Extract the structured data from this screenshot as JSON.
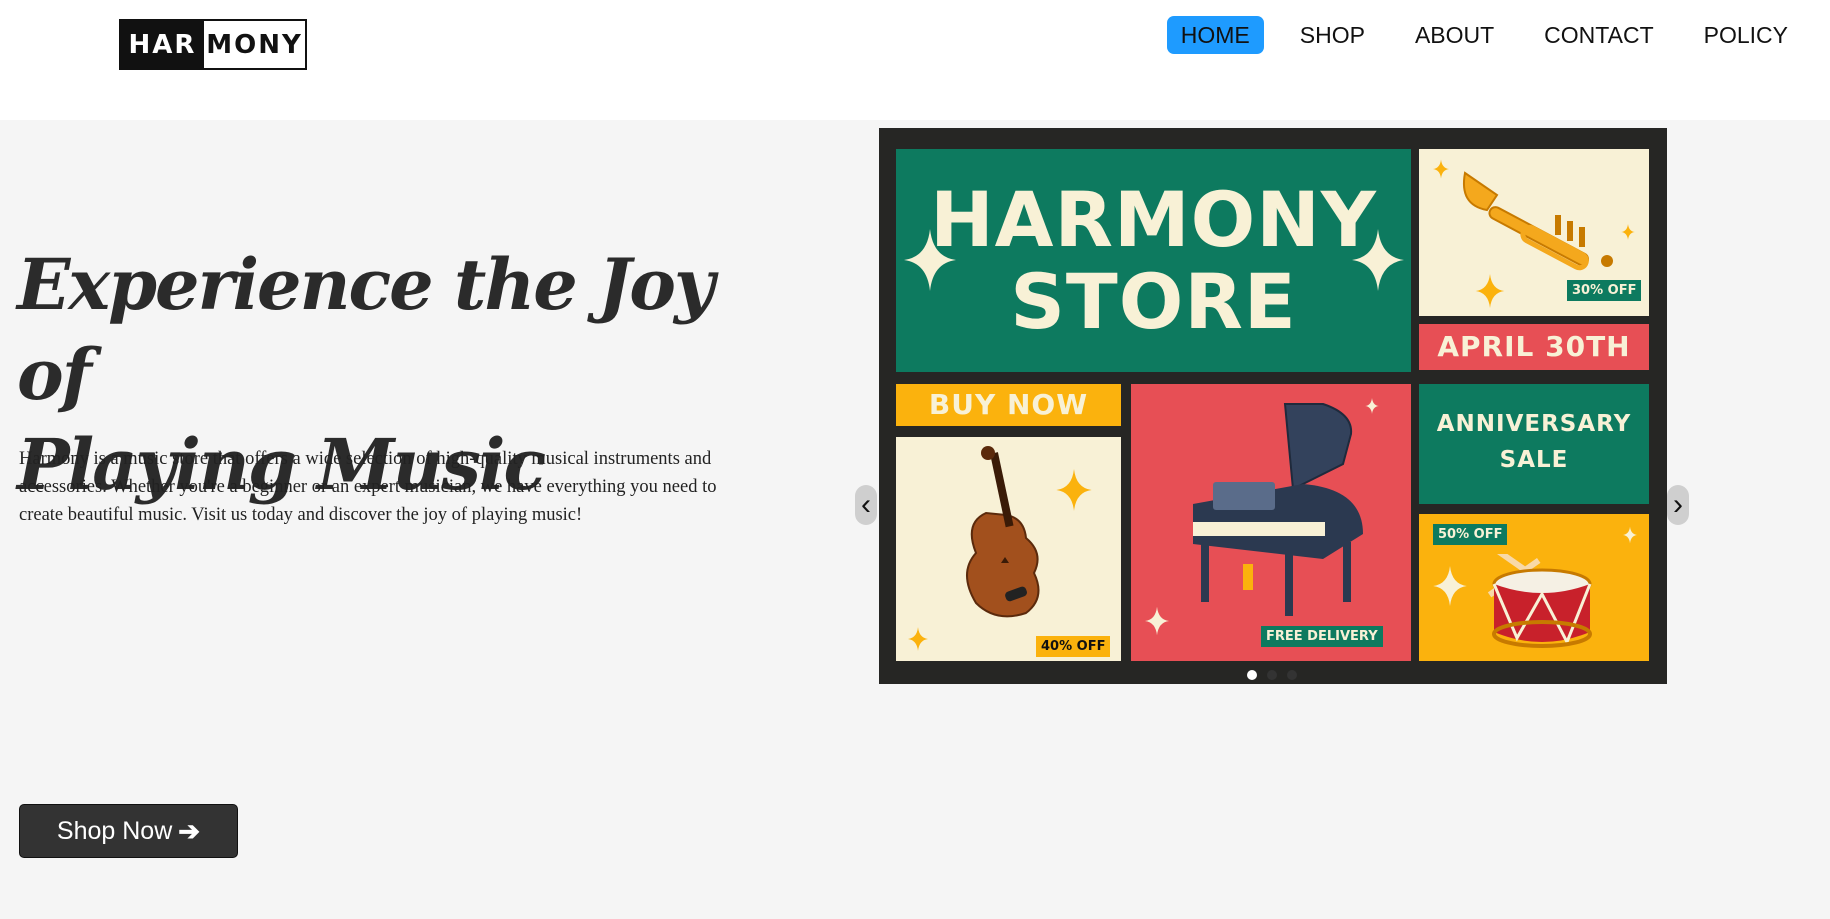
{
  "header": {
    "logo": {
      "left": "HAR",
      "right": "MONY"
    },
    "nav": [
      {
        "label": "HOME",
        "active": true
      },
      {
        "label": "SHOP",
        "active": false
      },
      {
        "label": "ABOUT",
        "active": false
      },
      {
        "label": "CONTACT",
        "active": false
      },
      {
        "label": "POLICY",
        "active": false
      }
    ]
  },
  "hero": {
    "headline_line1": "Experience the Joy of",
    "headline_line2": "Playing Music",
    "description": "Harmony is a music store that offers a wide selection of high-quality musical instruments and accessories. Whether you're a beginner or an expert musician, we have everything you need to create beautiful music. Visit us today and discover the joy of playing music!",
    "cta_label": "Shop Now",
    "cta_icon": "arrow-right-icon"
  },
  "carousel": {
    "banner": {
      "title_line1": "HARMONY",
      "title_line2": "STORE",
      "trumpet_tag": "30% OFF",
      "date": "APRIL 30TH",
      "buy_now": "BUY NOW",
      "violin_tag": "40% OFF",
      "piano_tag": "FREE DELIVERY",
      "anniversary_line1": "ANNIVERSARY",
      "anniversary_line2": "SALE",
      "drum_tag": "50% OFF"
    },
    "prev_icon": "chevron-left-icon",
    "next_icon": "chevron-right-icon",
    "slide_count": 3,
    "active_slide": 1
  },
  "colors": {
    "accent": "#1e9bff",
    "banner_green": "#0d7a5f",
    "banner_red": "#e74f55",
    "banner_yellow": "#fbb20d",
    "banner_cream": "#f8f1d6"
  }
}
